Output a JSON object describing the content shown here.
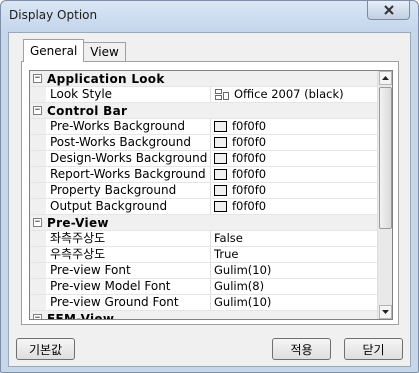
{
  "window": {
    "title": "Display Option"
  },
  "tabs": [
    {
      "label": "General"
    },
    {
      "label": "View"
    }
  ],
  "categories": [
    {
      "label": "Application Look",
      "toggle": "⊟",
      "rows": [
        {
          "name": "Look Style",
          "value": "Office 2007 (black)",
          "kind": "style"
        }
      ]
    },
    {
      "label": "Control Bar",
      "toggle": "⊟",
      "rows": [
        {
          "name": "Pre-Works Background",
          "value": "f0f0f0",
          "kind": "color",
          "color": "#f0f0f0"
        },
        {
          "name": "Post-Works Background",
          "value": "f0f0f0",
          "kind": "color",
          "color": "#f0f0f0"
        },
        {
          "name": "Design-Works Background",
          "value": "f0f0f0",
          "kind": "color",
          "color": "#f0f0f0"
        },
        {
          "name": "Report-Works Background",
          "value": "f0f0f0",
          "kind": "color",
          "color": "#f0f0f0"
        },
        {
          "name": "Property Background",
          "value": "f0f0f0",
          "kind": "color",
          "color": "#f0f0f0"
        },
        {
          "name": "Output Background",
          "value": "f0f0f0",
          "kind": "color",
          "color": "#f0f0f0"
        }
      ]
    },
    {
      "label": "Pre-View",
      "toggle": "⊟",
      "rows": [
        {
          "name": "좌측주상도",
          "value": "False",
          "kind": "text"
        },
        {
          "name": "우측주상도",
          "value": "True",
          "kind": "text"
        },
        {
          "name": "Pre-view Font",
          "value": "Gulim(10)",
          "kind": "text"
        },
        {
          "name": "Pre-view Model Font",
          "value": "Gulim(8)",
          "kind": "text"
        },
        {
          "name": "Pre-view Ground Font",
          "value": "Gulim(10)",
          "kind": "text"
        }
      ]
    },
    {
      "label": "FEM-View",
      "toggle": "⊟",
      "rows": []
    }
  ],
  "buttons": {
    "default": "기본값",
    "apply": "적용",
    "close": "닫기"
  },
  "colors": {
    "window_frame": "#c7d7ea",
    "client": "#f0f0f0"
  },
  "icons": {
    "close": "close-icon",
    "collapse": "minus-box-icon",
    "scroll_up": "arrow-up-icon",
    "scroll_down": "arrow-down-icon"
  }
}
